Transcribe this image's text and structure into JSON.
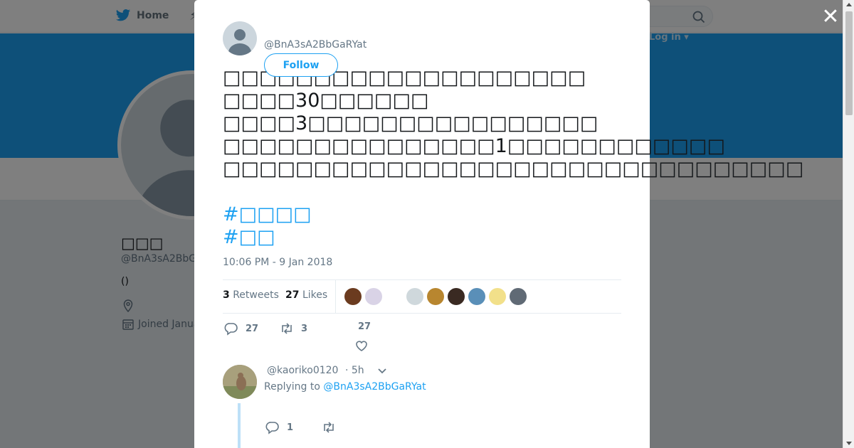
{
  "background": {
    "nav": {
      "home_label": "Home",
      "moments_glyph": "⚡",
      "login_label": "Log in ▾"
    },
    "profile": {
      "name": "□□□",
      "handle": "@BnA3sA2BbG",
      "bio": "()",
      "joined": "Joined Janua"
    },
    "colors": {
      "banner": "#1da1f2",
      "overlay": "rgba(0,0,0,0.5)"
    }
  },
  "modal": {
    "close_glyph": "✕",
    "tweet": {
      "handle": "@BnA3sA2BbGaRYat",
      "follow_label": "Follow",
      "lines": [
        "□□□□□□□□□□□□□□□□□□□□",
        "□□□□30□□□□□□",
        "□□□□3□□□□□□□□□□□□□□□□",
        "□□□□□□□□□□□□□□□1□□□□□□□□□□□□",
        "□□□□□□□□□□□□□□□□□□□□□□□□□□□□□□□□"
      ],
      "hashtags": [
        "#□□□□",
        "#□□"
      ],
      "timestamp": "10:06 PM - 9 Jan 2018"
    },
    "stats": {
      "retweets_count": "3",
      "retweets_label": "Retweets",
      "likes_count": "27",
      "likes_label": "Likes",
      "liker_avatar_colors": [
        "#6b3b1f",
        "#d9d3e6",
        "#cfd8dc",
        "#b8862f",
        "#3a2a22",
        "#5a8fb8",
        "#f2e08a",
        "#606a75"
      ]
    },
    "actions": {
      "reply_count": "27",
      "retweet_count": "3",
      "like_count": "27"
    },
    "reply": {
      "handle": "@kaoriko0120",
      "time": "· 5h",
      "replying_prefix": "Replying to",
      "replying_to": "@BnA3sA2BbGaRYat",
      "reply_count": "1"
    },
    "colors": {
      "accent": "#1da1f2",
      "muted": "#657786"
    }
  }
}
